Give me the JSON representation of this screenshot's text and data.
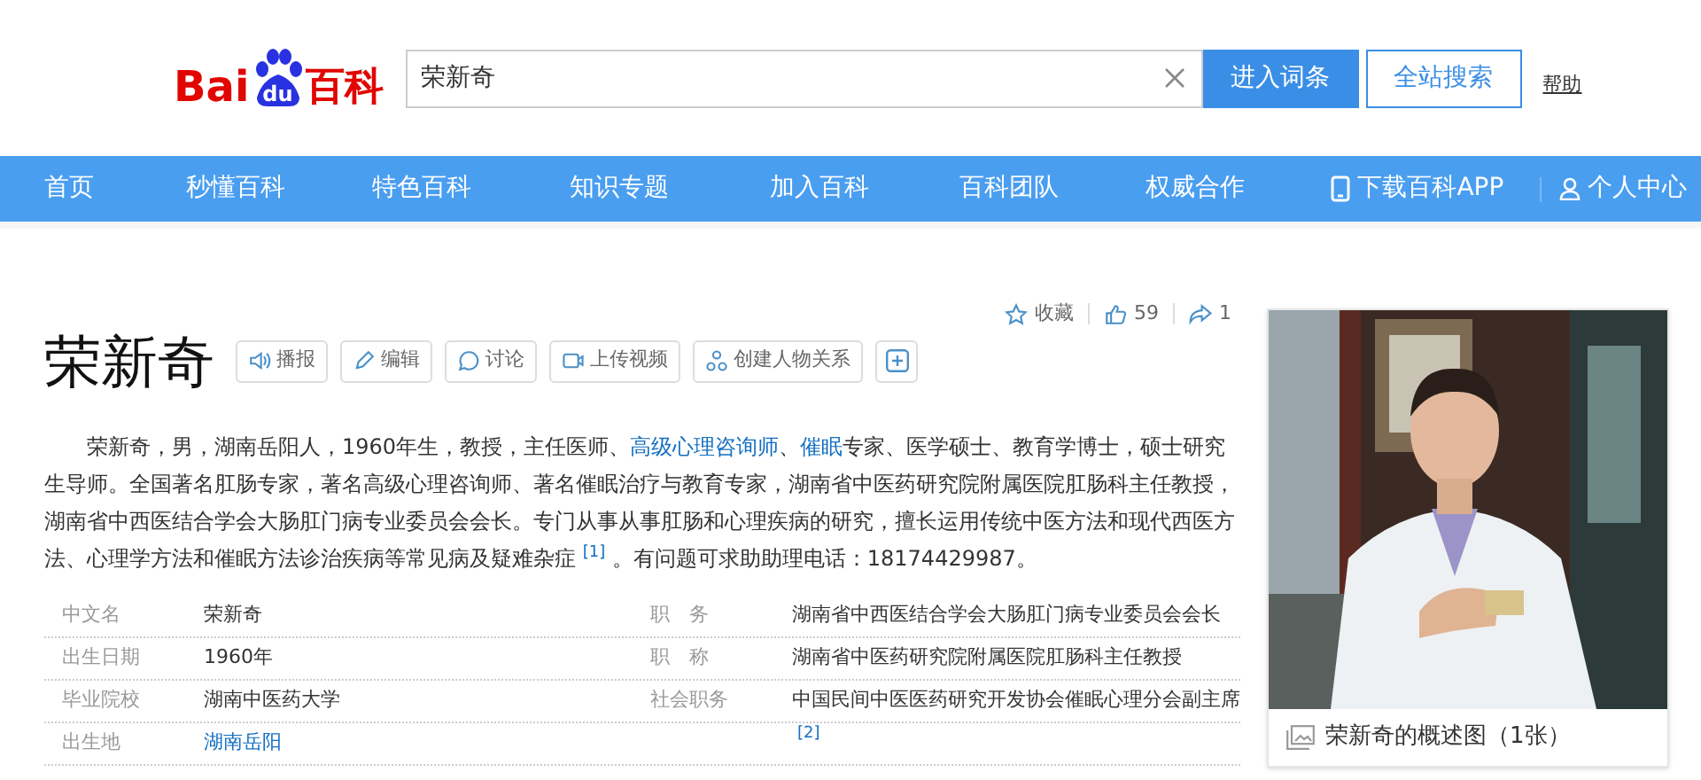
{
  "header": {
    "logo": {
      "part_1": "Bai",
      "part_2": "du",
      "part_3": "百科"
    },
    "search": {
      "value": "荣新奇"
    },
    "buttons": [
      {
        "label": "进入词条",
        "kind": "primary"
      },
      {
        "label": "全站搜索",
        "kind": "secondary"
      }
    ],
    "help_link": "帮助"
  },
  "nav": {
    "items": [
      {
        "label": "首页",
        "kind": "text"
      },
      {
        "label": "秒懂百科",
        "kind": "text"
      },
      {
        "label": "特色百科",
        "kind": "text"
      },
      {
        "label": "知识专题",
        "kind": "text"
      },
      {
        "label": "加入百科",
        "kind": "text"
      },
      {
        "label": "百科团队",
        "kind": "text"
      },
      {
        "label": "权威合作",
        "kind": "text"
      },
      {
        "label": "下载百科APP",
        "kind": "app"
      },
      {
        "label": "个人中心",
        "kind": "user"
      }
    ]
  },
  "entry": {
    "title": "荣新奇",
    "tools": [
      {
        "label": "播报",
        "kind": "speaker"
      },
      {
        "label": "编辑",
        "kind": "pencil"
      },
      {
        "label": "讨论",
        "kind": "chat"
      },
      {
        "label": "上传视频",
        "kind": "video"
      },
      {
        "label": "创建人物关系",
        "kind": "relation"
      }
    ],
    "stats": [
      {
        "label": "收藏",
        "kind": "star"
      },
      {
        "label": "59",
        "kind": "like"
      },
      {
        "label": "1",
        "kind": "share"
      }
    ],
    "summary": [
      {
        "text": "荣新奇，男，湖南岳阳人，1960年生，教授，主任医师、",
        "kind": "text"
      },
      {
        "text": "高级心理咨询师",
        "kind": "link"
      },
      {
        "text": "、",
        "kind": "text"
      },
      {
        "text": "催眠",
        "kind": "link"
      },
      {
        "text": "专家、医学硕士、教育学博士，硕士研究生导师。全国著名肛肠专家，著名高级心理咨询师、著名催眠治疗与教育专家，湖南省中医药研究院附属医院肛肠科主任教授，湖南省中西医结合学会大肠肛门病专业委员会会长。专门从事从事肛肠和心理疾病的研究，擅长运用传统中医方法和现代西医方法、心理学方法和催眠方法诊治疾病等常见病及疑难杂症 ",
        "kind": "text"
      },
      {
        "text": "[1]",
        "kind": "ref"
      },
      {
        "text": " 。有问题可求助助理电话：18174429987。",
        "kind": "text"
      }
    ],
    "info_rows": [
      {
        "label_1": "中文名",
        "value_1": {
          "text": "荣新奇",
          "kind": "text"
        },
        "label_2": "职　务",
        "value_2": {
          "text": "湖南省中西医结合学会大肠肛门病专业委员会会长",
          "kind": "text"
        }
      },
      {
        "label_1": "出生日期",
        "value_1": {
          "text": "1960年",
          "kind": "text"
        },
        "label_2": "职　称",
        "value_2": {
          "text": "湖南省中医药研究院附属医院肛肠科主任教授",
          "kind": "text"
        }
      },
      {
        "label_1": "毕业院校",
        "value_1": {
          "text": "湖南中医药大学",
          "kind": "text"
        },
        "label_2": "社会职务",
        "value_2": {
          "text": "中国民间中医医药研究开发协会催眠心理分会副主席",
          "kind": "text"
        }
      },
      {
        "label_1": "出生地",
        "value_1": {
          "text": "湖南岳阳",
          "kind": "link"
        },
        "value_2": {
          "text": "[2]",
          "kind": "ref"
        }
      }
    ],
    "album": {
      "caption": "荣新奇的概述图（1张）"
    }
  }
}
